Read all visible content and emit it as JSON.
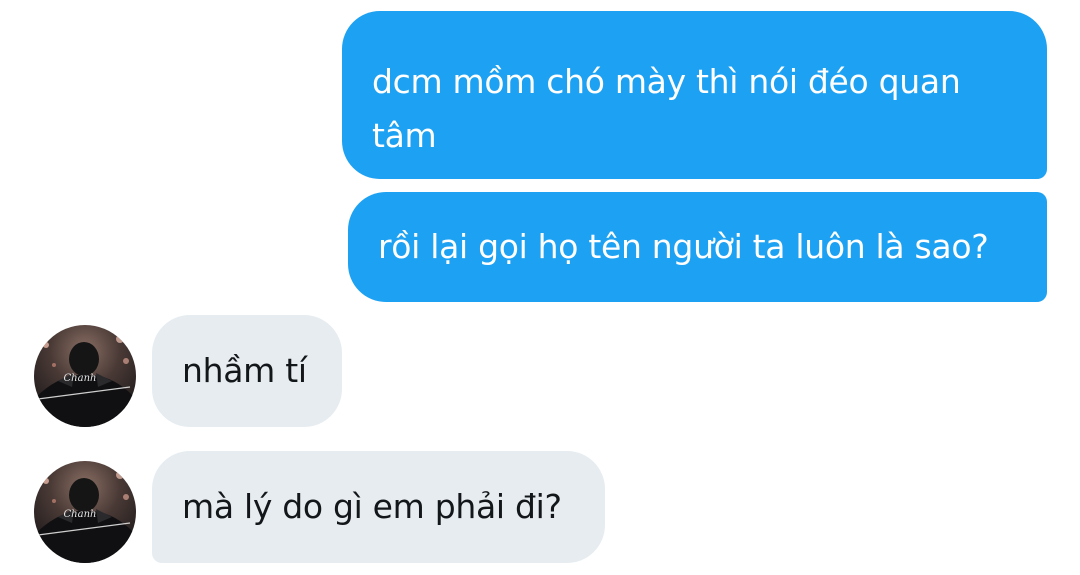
{
  "conversation": {
    "messages": [
      {
        "direction": "sent",
        "text": "dcm mồm chó mày thì nói đéo quan tâm"
      },
      {
        "direction": "sent",
        "text": "rồi lại gọi họ tên người ta luôn là sao?"
      },
      {
        "direction": "received",
        "text": "nhầm tí"
      },
      {
        "direction": "received",
        "text": "mà lý do gì em phải đi?"
      }
    ]
  },
  "colors": {
    "sent_bubble": "#1da1f2",
    "received_bubble": "#e6ecf0",
    "sent_text": "#ffffff",
    "received_text": "#14171a"
  },
  "avatar": {
    "icon": "user-avatar-photo",
    "shirt_text": "Chanh"
  }
}
